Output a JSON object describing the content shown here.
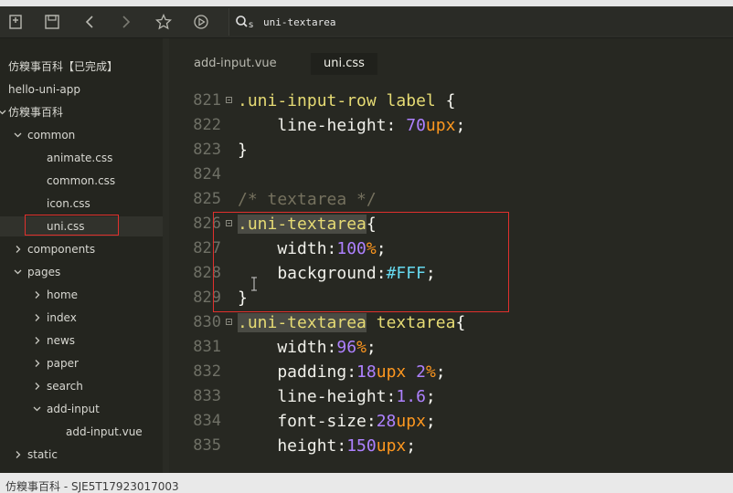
{
  "toolbar": {
    "search_value": "uni-textarea",
    "search_prefix": "s"
  },
  "sidebar": {
    "items": [
      {
        "label": "仿糗事百科【已完成】",
        "depth": 0,
        "chevron": "none"
      },
      {
        "label": "hello-uni-app",
        "depth": 0,
        "chevron": "none"
      },
      {
        "label": "仿糗事百科",
        "depth": 0,
        "chevron": "down"
      },
      {
        "label": "common",
        "depth": 1,
        "chevron": "down"
      },
      {
        "label": "animate.css",
        "depth": 2,
        "chevron": "none"
      },
      {
        "label": "common.css",
        "depth": 2,
        "chevron": "none"
      },
      {
        "label": "icon.css",
        "depth": 2,
        "chevron": "none"
      },
      {
        "label": "uni.css",
        "depth": 2,
        "chevron": "none",
        "selected": true
      },
      {
        "label": "components",
        "depth": 1,
        "chevron": "right"
      },
      {
        "label": "pages",
        "depth": 1,
        "chevron": "down"
      },
      {
        "label": "home",
        "depth": 2,
        "chevron": "right"
      },
      {
        "label": "index",
        "depth": 2,
        "chevron": "right"
      },
      {
        "label": "news",
        "depth": 2,
        "chevron": "right"
      },
      {
        "label": "paper",
        "depth": 2,
        "chevron": "right"
      },
      {
        "label": "search",
        "depth": 2,
        "chevron": "right"
      },
      {
        "label": "add-input",
        "depth": 2,
        "chevron": "down"
      },
      {
        "label": "add-input.vue",
        "depth": 3,
        "chevron": "none"
      },
      {
        "label": "static",
        "depth": 1,
        "chevron": "right"
      }
    ]
  },
  "editor": {
    "tabs": [
      {
        "label": "add-input.vue",
        "active": false
      },
      {
        "label": "uni.css",
        "active": true
      }
    ],
    "lines": [
      {
        "n": "821",
        "fold": true,
        "tokens": [
          [
            "sel",
            ".uni-input-row label"
          ],
          [
            "pun",
            " {"
          ]
        ]
      },
      {
        "n": "822",
        "fold": false,
        "tokens": [
          [
            "prop",
            "    line-height: "
          ],
          [
            "num",
            "70"
          ],
          [
            "unit",
            "upx"
          ],
          [
            "pun",
            ";"
          ]
        ]
      },
      {
        "n": "823",
        "fold": false,
        "tokens": [
          [
            "pun",
            "}"
          ]
        ]
      },
      {
        "n": "824",
        "fold": false,
        "tokens": []
      },
      {
        "n": "825",
        "fold": false,
        "tokens": [
          [
            "cmt",
            "/* textarea */"
          ]
        ]
      },
      {
        "n": "826",
        "fold": true,
        "tokens": [
          [
            "sel hl",
            ".uni-textarea"
          ],
          [
            "pun",
            "{"
          ]
        ]
      },
      {
        "n": "827",
        "fold": false,
        "tokens": [
          [
            "prop",
            "    width:"
          ],
          [
            "num",
            "100"
          ],
          [
            "unit",
            "%"
          ],
          [
            "pun",
            ";"
          ]
        ]
      },
      {
        "n": "828",
        "fold": false,
        "tokens": [
          [
            "prop",
            "    background:"
          ],
          [
            "hex",
            "#FFF"
          ],
          [
            "pun",
            ";"
          ]
        ]
      },
      {
        "n": "829",
        "fold": false,
        "tokens": [
          [
            "pun",
            "}"
          ]
        ]
      },
      {
        "n": "830",
        "fold": true,
        "tokens": [
          [
            "sel hl",
            ".uni-textarea"
          ],
          [
            "sel",
            " textarea"
          ],
          [
            "pun",
            "{"
          ]
        ]
      },
      {
        "n": "831",
        "fold": false,
        "tokens": [
          [
            "prop",
            "    width:"
          ],
          [
            "num",
            "96"
          ],
          [
            "unit",
            "%"
          ],
          [
            "pun",
            ";"
          ]
        ]
      },
      {
        "n": "832",
        "fold": false,
        "tokens": [
          [
            "prop",
            "    padding:"
          ],
          [
            "num",
            "18"
          ],
          [
            "unit",
            "upx"
          ],
          [
            "prop",
            " "
          ],
          [
            "num",
            "2"
          ],
          [
            "unit",
            "%"
          ],
          [
            "pun",
            ";"
          ]
        ]
      },
      {
        "n": "833",
        "fold": false,
        "tokens": [
          [
            "prop",
            "    line-height:"
          ],
          [
            "num",
            "1.6"
          ],
          [
            "pun",
            ";"
          ]
        ]
      },
      {
        "n": "834",
        "fold": false,
        "tokens": [
          [
            "prop",
            "    font-size:"
          ],
          [
            "num",
            "28"
          ],
          [
            "unit",
            "upx"
          ],
          [
            "pun",
            ";"
          ]
        ]
      },
      {
        "n": "835",
        "fold": false,
        "tokens": [
          [
            "prop",
            "    height:"
          ],
          [
            "num",
            "150"
          ],
          [
            "unit",
            "upx"
          ],
          [
            "pun",
            ";"
          ]
        ]
      }
    ]
  },
  "statusbar": {
    "text": "仿糗事百科 - SJE5T17923017003"
  },
  "colors": {
    "background": "#272822",
    "annotation_red": "#e0302d",
    "selector": "#e6db74",
    "number": "#ae81ff",
    "unit": "#fd971f",
    "comment": "#75715e"
  }
}
